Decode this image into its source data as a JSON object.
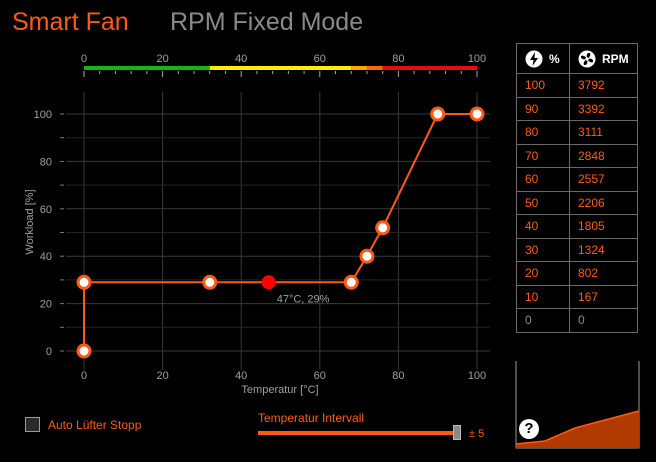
{
  "tabs": {
    "smart_fan": "Smart Fan",
    "rpm_fixed": "RPM Fixed Mode"
  },
  "colors": {
    "accent": "#ff5a14",
    "point": "#ff0000",
    "grid": "#3a3a3a"
  },
  "chart_data": {
    "type": "line",
    "xlabel": "Temperatur [°C]",
    "ylabel": "Workload [%]",
    "xlim": [
      0,
      100
    ],
    "ylim": [
      0,
      100
    ],
    "x_ticks": [
      0,
      20,
      40,
      60,
      80,
      100
    ],
    "y_ticks": [
      0,
      20,
      40,
      60,
      80,
      100
    ],
    "top_scale_ticks": [
      0,
      20,
      40,
      60,
      80,
      100
    ],
    "top_scale_bands": [
      {
        "from": 0,
        "to": 32,
        "color": "#16b416"
      },
      {
        "from": 32,
        "to": 68,
        "color": "#ffee00"
      },
      {
        "from": 68,
        "to": 72,
        "color": "#ffa500"
      },
      {
        "from": 72,
        "to": 76,
        "color": "#ff6a00"
      },
      {
        "from": 76,
        "to": 100,
        "color": "#e01010"
      }
    ],
    "series": [
      {
        "x": [
          0,
          0,
          32,
          68,
          72,
          76,
          90,
          100
        ],
        "y": [
          0,
          29,
          29,
          29,
          40,
          52,
          100,
          100
        ]
      }
    ],
    "current_point": {
      "x": 47,
      "y": 29,
      "label": "47°C, 29%"
    },
    "grid": true
  },
  "rpm_table": {
    "headers": {
      "percent": "%",
      "rpm": "RPM"
    },
    "rows": [
      {
        "percent": "100",
        "rpm": "3792"
      },
      {
        "percent": "90",
        "rpm": "3392"
      },
      {
        "percent": "80",
        "rpm": "3111"
      },
      {
        "percent": "70",
        "rpm": "2848"
      },
      {
        "percent": "60",
        "rpm": "2557"
      },
      {
        "percent": "50",
        "rpm": "2206"
      },
      {
        "percent": "40",
        "rpm": "1805"
      },
      {
        "percent": "30",
        "rpm": "1324"
      },
      {
        "percent": "20",
        "rpm": "802"
      },
      {
        "percent": "10",
        "rpm": "167"
      },
      {
        "percent": "0",
        "rpm": "0"
      }
    ]
  },
  "auto_stop": {
    "label": "Auto Lüfter Stopp",
    "checked": false
  },
  "interval": {
    "label": "Temperatur Intervall",
    "value_label": "± 5",
    "value": 5
  },
  "help": {
    "label": "?"
  },
  "icons": {
    "percent_header": "bolt-icon",
    "rpm_header": "fan-icon"
  }
}
